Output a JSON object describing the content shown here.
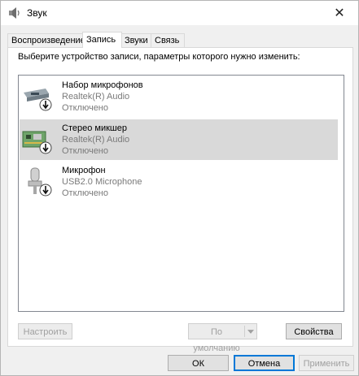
{
  "window": {
    "title": "Звук",
    "close_glyph": "✕"
  },
  "tabs": [
    {
      "label": "Воспроизведение"
    },
    {
      "label": "Запись"
    },
    {
      "label": "Звуки"
    },
    {
      "label": "Связь"
    }
  ],
  "instruction": "Выберите устройство записи, параметры которого нужно изменить:",
  "devices": [
    {
      "name": "Набор микрофонов",
      "driver": "Realtek(R) Audio",
      "status": "Отключено",
      "icon": "mic-array-icon",
      "selected": false
    },
    {
      "name": "Стерео микшер",
      "driver": "Realtek(R) Audio",
      "status": "Отключено",
      "icon": "sound-card-icon",
      "selected": true
    },
    {
      "name": "Микрофон",
      "driver": "USB2.0 Microphone",
      "status": "Отключено",
      "icon": "microphone-icon",
      "selected": false
    }
  ],
  "panel_buttons": {
    "configure": "Настроить",
    "default": "По умолчанию",
    "properties": "Свойства"
  },
  "dialog_buttons": {
    "ok": "ОК",
    "cancel": "Отмена",
    "apply": "Применить"
  },
  "colors": {
    "accent": "#0078d7",
    "selection": "#d9d9d9",
    "disabled_text": "#a0a0a0"
  }
}
